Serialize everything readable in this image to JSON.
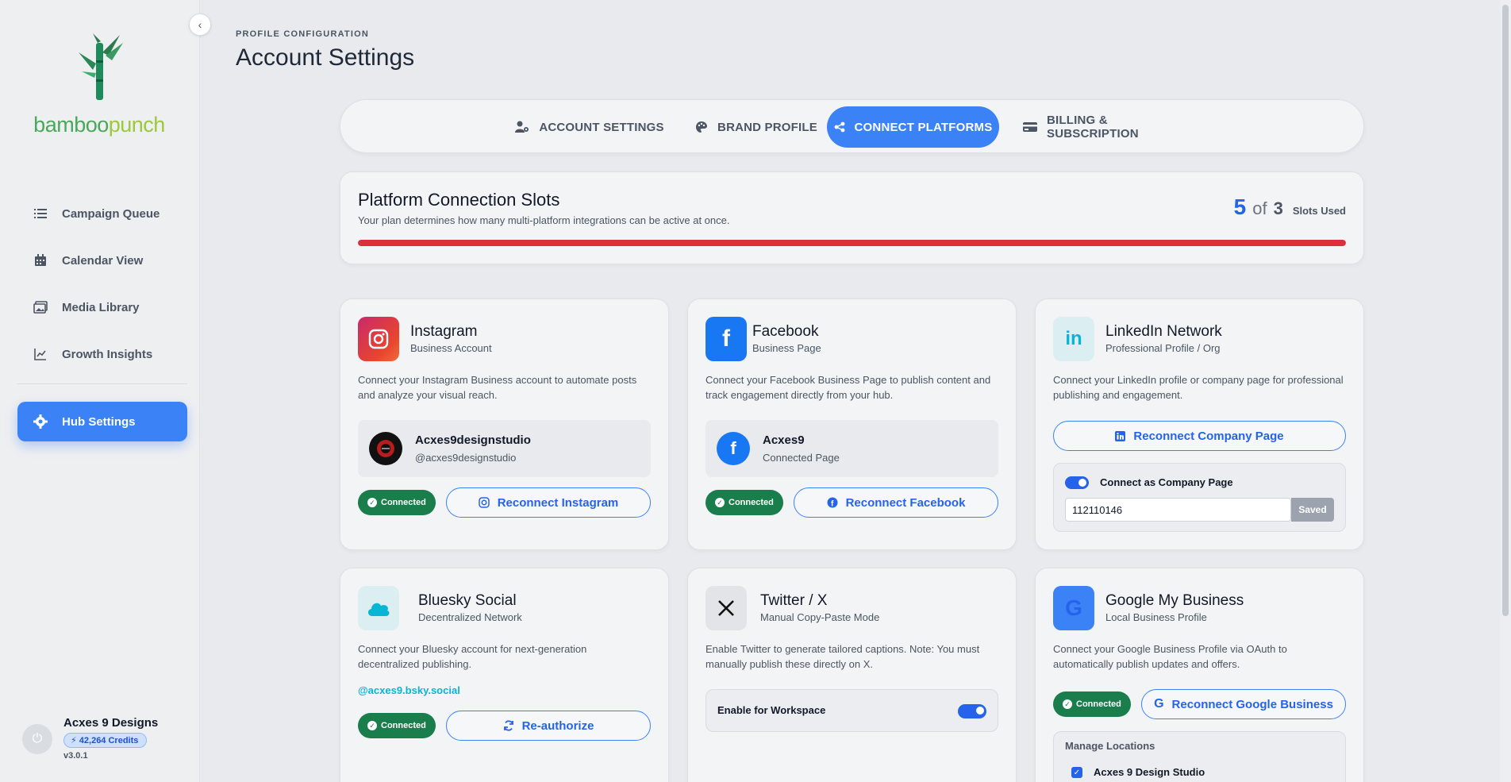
{
  "brand": {
    "part1": "bamboo",
    "part2": "punch"
  },
  "sidebar": {
    "items": [
      {
        "label": "Campaign Queue",
        "icon": "list-icon"
      },
      {
        "label": "Calendar View",
        "icon": "calendar-icon"
      },
      {
        "label": "Media Library",
        "icon": "images-icon"
      },
      {
        "label": "Growth Insights",
        "icon": "chart-line-icon"
      }
    ],
    "active": {
      "label": "Hub Settings",
      "icon": "gear-icon"
    },
    "user": {
      "name": "Acxes 9 Designs",
      "credits": "42,264 Credits",
      "version": "v3.0.1"
    }
  },
  "header": {
    "eyebrow": "PROFILE CONFIGURATION",
    "title": "Account Settings"
  },
  "tabs": [
    {
      "label": "ACCOUNT SETTINGS",
      "icon": "user-gear-icon"
    },
    {
      "label": "BRAND PROFILE",
      "icon": "palette-icon"
    },
    {
      "label": "CONNECT PLATFORMS",
      "icon": "share-icon",
      "active": true
    },
    {
      "label": "BILLING & SUBSCRIPTION",
      "icon": "credit-card-icon"
    }
  ],
  "slots": {
    "title": "Platform Connection Slots",
    "subtitle": "Your plan determines how many multi-platform integrations can be active at once.",
    "used": "5",
    "of": "of",
    "total": "3",
    "label": "Slots Used",
    "progress_fraction": 1.0,
    "bar_color": "#dc2f3c"
  },
  "platforms": {
    "instagram": {
      "name": "Instagram",
      "type": "Business Account",
      "desc": "Connect your Instagram Business account to automate posts and analyze your visual reach.",
      "account_name": "Acxes9designstudio",
      "account_handle": "@acxes9designstudio",
      "status": "Connected",
      "button": "Reconnect Instagram"
    },
    "facebook": {
      "name": "Facebook",
      "type": "Business Page",
      "desc": "Connect your Facebook Business Page to publish content and track engagement directly from your hub.",
      "account_name": "Acxes9",
      "account_handle": "Connected Page",
      "status": "Connected",
      "button": "Reconnect Facebook"
    },
    "linkedin": {
      "name": "LinkedIn Network",
      "type": "Professional Profile / Org",
      "desc": "Connect your LinkedIn profile or company page for professional publishing and engagement.",
      "button": "Reconnect Company Page",
      "toggle_label": "Connect as Company Page",
      "company_id": "112110146",
      "saved": "Saved"
    },
    "bluesky": {
      "name": "Bluesky Social",
      "type": "Decentralized Network",
      "desc": "Connect your Bluesky account for next-generation decentralized publishing.",
      "handle": "@acxes9.bsky.social",
      "status": "Connected",
      "button": "Re-authorize"
    },
    "twitter": {
      "name": "Twitter / X",
      "type": "Manual Copy-Paste Mode",
      "desc": "Enable Twitter to generate tailored captions. Note: You must manually publish these directly on X.",
      "toggle_label": "Enable for Workspace"
    },
    "google": {
      "name": "Google My Business",
      "type": "Local Business Profile",
      "desc": "Connect your Google Business Profile via OAuth to automatically publish updates and offers.",
      "status": "Connected",
      "button": "Reconnect Google Business",
      "locations_title": "Manage Locations",
      "location": "Acxes 9 Design Studio"
    }
  }
}
